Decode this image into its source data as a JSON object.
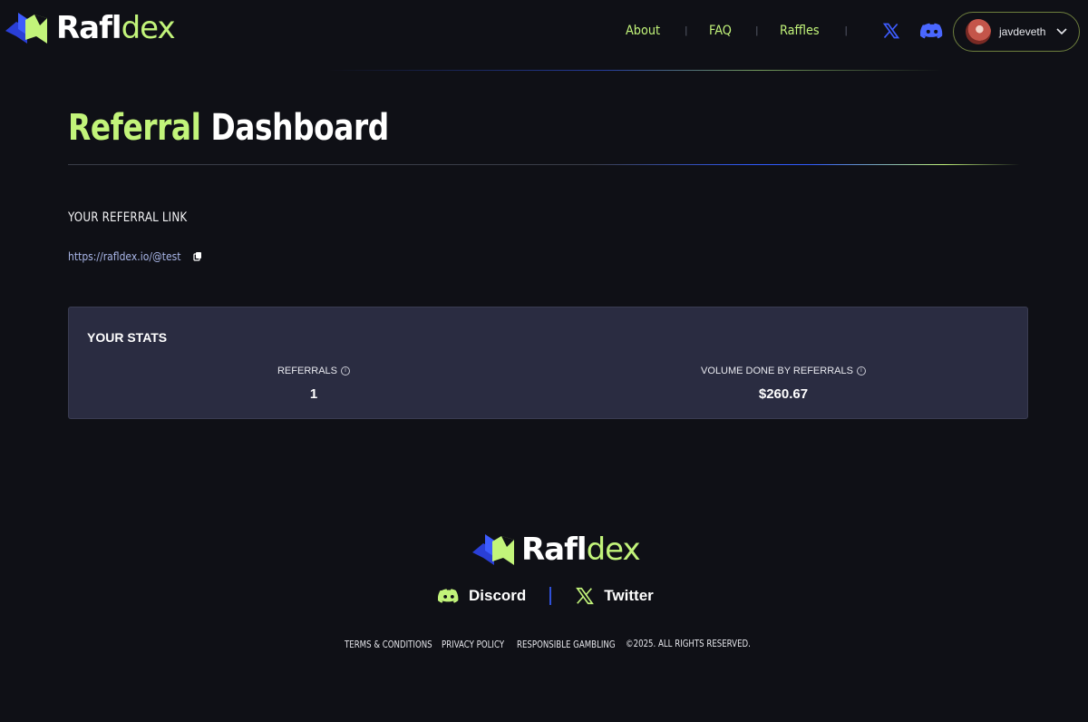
{
  "brand": {
    "name_primary": "Rafl",
    "name_secondary": "dex"
  },
  "nav": {
    "items": [
      {
        "label": "About"
      },
      {
        "label": "FAQ"
      },
      {
        "label": "Raffles"
      }
    ],
    "separator": "|",
    "icons": [
      "x-twitter-icon",
      "discord-icon"
    ]
  },
  "user": {
    "username": "javdeveth",
    "menu_icon": "chevron-down-icon"
  },
  "page": {
    "title_accent": "Referral",
    "title_rest": "Dashboard"
  },
  "referral": {
    "label": "YOUR REFERRAL LINK",
    "link": "https://rafldex.io/@test",
    "copy_icon": "copy-icon"
  },
  "stats": {
    "title": "YOUR STATS",
    "referrals_label": "REFERRALS",
    "referrals_value": "1",
    "volume_label": "VOLUME DONE BY REFERRALS",
    "volume_value": "$260.67",
    "info_icon": "info-icon"
  },
  "footer": {
    "discord_label": "Discord",
    "twitter_label": "Twitter",
    "links": [
      "TERMS & CONDITIONS",
      "PRIVACY POLICY",
      "RESPONSIBLE GAMBLING"
    ],
    "copyright": "©2025. ALL RIGHTS RESERVED."
  },
  "colors": {
    "accent_green": "#c2f47a",
    "accent_blue": "#2f50d8",
    "background": "#0f1016",
    "card": "#2a2c41"
  }
}
